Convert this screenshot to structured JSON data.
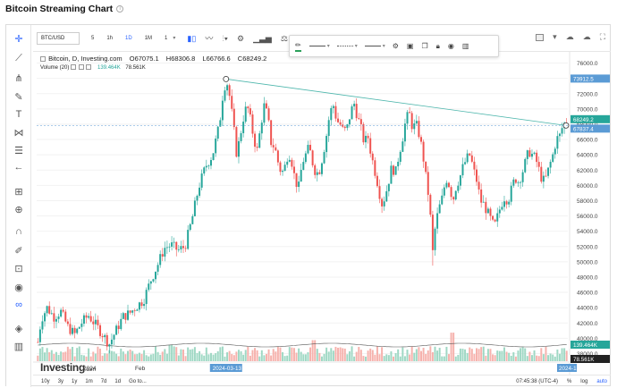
{
  "page": {
    "title": "Bitcoin Streaming Chart"
  },
  "toolbar": {
    "symbol": "BTC/USD",
    "timeframes": [
      {
        "label": "5",
        "active": false
      },
      {
        "label": "1h",
        "active": false
      },
      {
        "label": "1D",
        "active": true
      },
      {
        "label": "1M",
        "active": false
      },
      {
        "label": "1",
        "active": false
      }
    ],
    "icons": [
      "candles-icon",
      "line-chart-icon",
      "bar-type-icon",
      "settings-gear-icon",
      "indicators-icon",
      "compare-icon"
    ]
  },
  "drawing_toolbar": {
    "icons": [
      "pencil-icon",
      "line-style-solid-icon",
      "line-style-dashed-icon",
      "line-style-arrow-icon",
      "settings-icon",
      "template-icon",
      "copy-icon",
      "lock-icon",
      "visibility-icon",
      "delete-icon"
    ]
  },
  "sidebar": {
    "icons": [
      "crosshair-icon",
      "trendline-icon",
      "pitchfork-icon",
      "brush-icon",
      "text-icon",
      "pattern-icon",
      "prediction-icon",
      "arrow-back-icon",
      "measure-icon",
      "zoom-in-icon",
      "magnet-icon",
      "lock-drawings-icon",
      "unlock-icon",
      "eye-icon",
      "link-icon",
      "layers-icon",
      "trash-icon"
    ]
  },
  "legend": {
    "symbol_line": "Bitcoin, D, Investing.com",
    "open": "O67075.1",
    "high": "H68306.8",
    "low": "L66766.6",
    "close": "C68249.2",
    "volume_label": "Volume (20)",
    "volume_value": "139.464K",
    "volume_ma": "78.561K"
  },
  "watermark": {
    "brand": "Investing",
    "suffix": ".com"
  },
  "price_axis": {
    "ticks": [
      "76000.0",
      "74000.0",
      "72000.0",
      "70000.0",
      "68000.0",
      "66000.0",
      "64000.0",
      "62000.0",
      "60000.0",
      "58000.0",
      "56000.0",
      "54000.0",
      "52000.0",
      "50000.0",
      "48000.0",
      "46000.0",
      "44000.0",
      "42000.0",
      "40000.0",
      "38000.0"
    ],
    "markers": [
      {
        "label": "73912.5",
        "color": "#5b9bd5"
      },
      {
        "label": "68249.2",
        "color": "#26a69a"
      },
      {
        "label": "67837.4",
        "color": "#5b9bd5"
      },
      {
        "label": "139.464K",
        "color": "#26a69a"
      },
      {
        "label": "78.561K",
        "color": "#222222"
      }
    ]
  },
  "time_axis": {
    "labels": [
      "2024",
      "Feb"
    ],
    "markers": [
      {
        "label": "2024-03-13",
        "color": "#5b9bd5"
      },
      {
        "label": "2024-1",
        "color": "#5b9bd5"
      }
    ]
  },
  "bottom_bar": {
    "ranges": [
      "10y",
      "3y",
      "1y",
      "1m",
      "7d",
      "1d",
      "Go to..."
    ],
    "clock": "07:45:38 (UTC-4)",
    "percent": "%",
    "log": "log",
    "auto": "auto"
  },
  "chart_data": {
    "type": "candlestick",
    "title": "",
    "ylim": [
      37000,
      77000
    ],
    "y_ticks": [
      38000,
      40000,
      42000,
      44000,
      46000,
      48000,
      50000,
      52000,
      54000,
      56000,
      58000,
      60000,
      62000,
      64000,
      66000,
      68000,
      70000,
      72000,
      74000,
      76000
    ],
    "colors": {
      "up": "#26a69a",
      "down": "#ef5350",
      "up_volume": "#9fd8c4",
      "down_volume": "#f6b2ad"
    },
    "price_path": [
      [
        0,
        39500
      ],
      [
        3,
        42500
      ],
      [
        8,
        44000
      ],
      [
        14,
        42800
      ],
      [
        20,
        43500
      ],
      [
        26,
        41500
      ],
      [
        32,
        40500
      ],
      [
        38,
        42000
      ],
      [
        44,
        43000
      ],
      [
        50,
        41800
      ],
      [
        56,
        40600
      ],
      [
        62,
        39200
      ],
      [
        68,
        41000
      ],
      [
        74,
        42800
      ],
      [
        80,
        43300
      ],
      [
        86,
        44200
      ],
      [
        92,
        45000
      ],
      [
        98,
        47500
      ],
      [
        104,
        49500
      ],
      [
        110,
        51800
      ],
      [
        116,
        52200
      ],
      [
        122,
        51500
      ],
      [
        128,
        52000
      ],
      [
        134,
        55500
      ],
      [
        140,
        59800
      ],
      [
        146,
        62500
      ],
      [
        152,
        64000
      ],
      [
        158,
        68000
      ],
      [
        161,
        72000
      ],
      [
        164,
        73900
      ],
      [
        167,
        71500
      ],
      [
        170,
        68000
      ],
      [
        173,
        64000
      ],
      [
        176,
        66500
      ],
      [
        179,
        69000
      ],
      [
        182,
        70500
      ],
      [
        185,
        68500
      ],
      [
        188,
        66000
      ],
      [
        191,
        64500
      ],
      [
        194,
        68000
      ],
      [
        197,
        70500
      ],
      [
        200,
        69000
      ],
      [
        203,
        65500
      ],
      [
        206,
        65000
      ],
      [
        209,
        63000
      ],
      [
        212,
        61500
      ],
      [
        215,
        62500
      ],
      [
        218,
        64500
      ],
      [
        221,
        63000
      ],
      [
        224,
        60500
      ],
      [
        227,
        59800
      ],
      [
        230,
        63000
      ],
      [
        233,
        64000
      ],
      [
        236,
        65000
      ],
      [
        239,
        63000
      ],
      [
        242,
        61500
      ],
      [
        245,
        62000
      ],
      [
        248,
        64000
      ],
      [
        251,
        66500
      ],
      [
        254,
        69500
      ],
      [
        257,
        70500
      ],
      [
        260,
        68500
      ],
      [
        263,
        68000
      ],
      [
        266,
        67000
      ],
      [
        269,
        67500
      ],
      [
        272,
        69500
      ],
      [
        275,
        70800
      ],
      [
        278,
        69000
      ],
      [
        281,
        67500
      ],
      [
        284,
        65500
      ],
      [
        287,
        66500
      ],
      [
        290,
        64000
      ],
      [
        293,
        62000
      ],
      [
        296,
        60000
      ],
      [
        299,
        57500
      ],
      [
        302,
        58500
      ],
      [
        305,
        60500
      ],
      [
        308,
        62500
      ],
      [
        311,
        61500
      ],
      [
        314,
        64000
      ],
      [
        317,
        66000
      ],
      [
        320,
        68500
      ],
      [
        323,
        69500
      ],
      [
        326,
        67500
      ],
      [
        329,
        68000
      ],
      [
        332,
        66500
      ],
      [
        335,
        64000
      ],
      [
        338,
        60500
      ],
      [
        341,
        57500
      ],
      [
        343,
        50500
      ],
      [
        346,
        55000
      ],
      [
        349,
        57000
      ],
      [
        352,
        58500
      ],
      [
        355,
        61000
      ],
      [
        358,
        60000
      ],
      [
        361,
        58000
      ],
      [
        364,
        60000
      ],
      [
        367,
        61000
      ],
      [
        370,
        62500
      ],
      [
        373,
        63500
      ],
      [
        376,
        64000
      ],
      [
        379,
        62000
      ],
      [
        382,
        60500
      ],
      [
        385,
        58000
      ],
      [
        388,
        57500
      ],
      [
        391,
        56500
      ],
      [
        394,
        55500
      ],
      [
        397,
        54500
      ],
      [
        400,
        56000
      ],
      [
        403,
        57500
      ],
      [
        406,
        58500
      ],
      [
        409,
        58000
      ],
      [
        412,
        59500
      ],
      [
        415,
        61000
      ],
      [
        418,
        60500
      ],
      [
        421,
        61500
      ],
      [
        424,
        63000
      ],
      [
        427,
        64500
      ],
      [
        430,
        64000
      ],
      [
        433,
        63500
      ],
      [
        436,
        62000
      ],
      [
        439,
        60500
      ],
      [
        442,
        61000
      ],
      [
        445,
        62500
      ],
      [
        448,
        64000
      ],
      [
        451,
        66000
      ],
      [
        454,
        66500
      ],
      [
        457,
        68000
      ],
      [
        460,
        68249
      ]
    ],
    "volume_spikes": [
      {
        "at": 0.78,
        "level": 0.95
      },
      {
        "at": 0.25,
        "level": 0.55
      },
      {
        "at": 0.52,
        "level": 0.7
      }
    ],
    "trendline": {
      "from": {
        "date": "2024-03-13",
        "price": 73912.5
      },
      "to": {
        "date": "latest",
        "price": 67837.4
      }
    },
    "last_price": 68249.2,
    "volume_last": "139.464K",
    "volume_ma": "78.561K"
  }
}
